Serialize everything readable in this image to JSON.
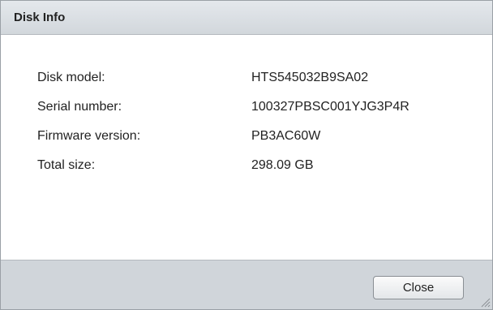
{
  "dialog": {
    "title": "Disk Info",
    "close_label": "Close"
  },
  "rows": [
    {
      "label": "Disk model:",
      "value": "HTS545032B9SA02"
    },
    {
      "label": "Serial number:",
      "value": "100327PBSC001YJG3P4R"
    },
    {
      "label": "Firmware version:",
      "value": "PB3AC60W"
    },
    {
      "label": "Total size:",
      "value": "298.09 GB"
    }
  ],
  "icons": {
    "resize_grip": "resize-grip-icon"
  },
  "colors": {
    "title_bar": "#d8dde2",
    "footer": "#d0d5da",
    "text": "#222222"
  }
}
